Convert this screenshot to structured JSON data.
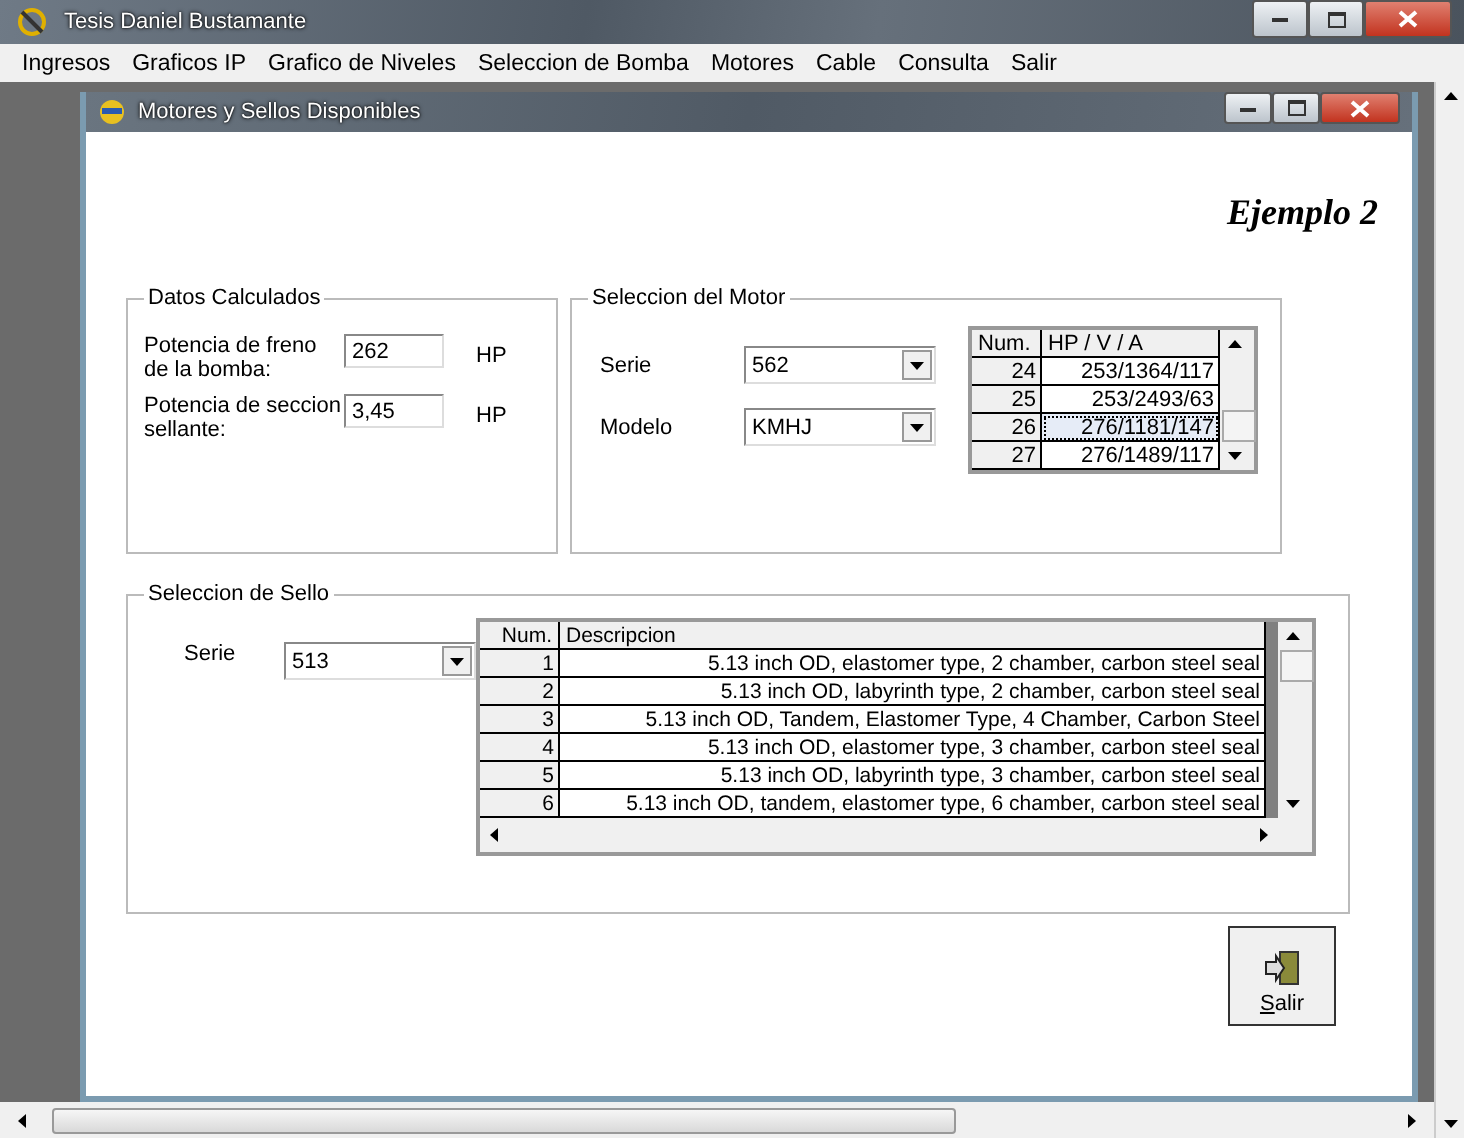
{
  "window": {
    "title": "Tesis Daniel Bustamante"
  },
  "menu": [
    "Ingresos",
    "Graficos IP",
    "Grafico de Niveles",
    "Seleccion de Bomba",
    "Motores",
    "Cable",
    "Consulta",
    "Salir"
  ],
  "child_window": {
    "title": "Motores y Sellos Disponibles",
    "heading": "Ejemplo 2",
    "datos_calculados": {
      "title": "Datos Calculados",
      "fields": [
        {
          "label": "Potencia de freno de la bomba:",
          "value": "262",
          "unit": "HP"
        },
        {
          "label": "Potencia de seccion sellante:",
          "value": "3,45",
          "unit": "HP"
        }
      ]
    },
    "seleccion_motor": {
      "title": "Seleccion del Motor",
      "dropdowns": [
        {
          "label": "Serie",
          "value": "562"
        },
        {
          "label": "Modelo",
          "value": "KMHJ"
        }
      ],
      "table": {
        "columns": [
          "Num.",
          "HP / V / A"
        ],
        "rows": [
          {
            "num": "24",
            "value": "253/1364/117",
            "selected": false
          },
          {
            "num": "25",
            "value": "253/2493/63",
            "selected": false
          },
          {
            "num": "26",
            "value": "276/1181/147",
            "selected": true
          },
          {
            "num": "27",
            "value": "276/1489/117",
            "selected": false
          }
        ]
      }
    },
    "seleccion_sello": {
      "title": "Seleccion de Sello",
      "dropdown": {
        "label": "Serie",
        "value": "513"
      },
      "table": {
        "columns": [
          "Num.",
          "Descripcion"
        ],
        "rows": [
          {
            "num": "1",
            "value": "5.13 inch OD, elastomer type, 2 chamber, carbon steel seal"
          },
          {
            "num": "2",
            "value": "5.13 inch OD, labyrinth type, 2 chamber, carbon steel seal"
          },
          {
            "num": "3",
            "value": "5.13 inch OD, Tandem, Elastomer Type, 4 Chamber, Carbon Steel"
          },
          {
            "num": "4",
            "value": "5.13 inch OD, elastomer type, 3 chamber, carbon steel seal"
          },
          {
            "num": "5",
            "value": "5.13 inch OD, labyrinth type, 3 chamber, carbon steel seal"
          },
          {
            "num": "6",
            "value": "5.13 inch OD, tandem, elastomer type, 6 chamber, carbon steel seal"
          }
        ]
      }
    },
    "exit_button": {
      "label": "Salir"
    }
  }
}
